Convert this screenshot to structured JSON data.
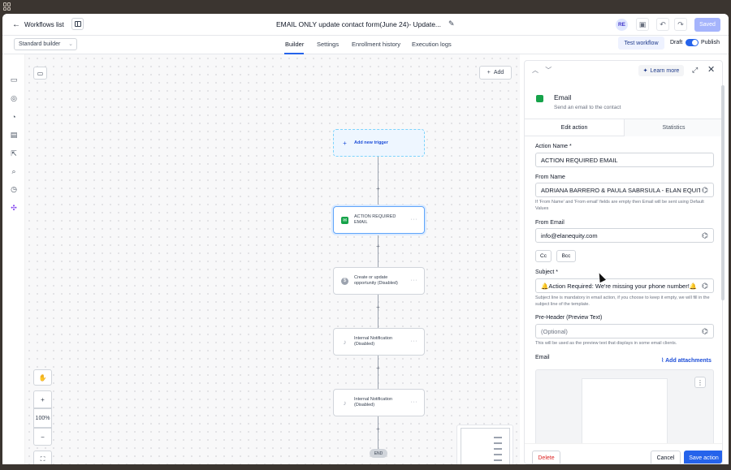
{
  "header": {
    "back_label": "Workflows list",
    "workflow_title": "EMAIL ONLY update contact form(June 24)- Update...",
    "avatar_initials": "RE",
    "saved_label": "Saved"
  },
  "subbar": {
    "builder_select": "Standard builder",
    "tabs": [
      {
        "label": "Builder",
        "active": true
      },
      {
        "label": "Settings",
        "active": false
      },
      {
        "label": "Enrollment history",
        "active": false
      },
      {
        "label": "Execution logs",
        "active": false
      }
    ],
    "test_label": "Test workflow",
    "draft_label": "Draft",
    "publish_label": "Publish",
    "published_on": true
  },
  "canvas": {
    "add_label": "Add",
    "nodes": [
      {
        "label": "Add new trigger",
        "kind": "trigger"
      },
      {
        "label": "ACTION REQUIRED EMAIL",
        "kind": "email",
        "selected": true
      },
      {
        "label": "Create or update opportunity (Disabled)",
        "kind": "opportunity"
      },
      {
        "label": "Internal Notification (Disabled)",
        "kind": "notification"
      },
      {
        "label": "Internal Notification (Disabled)",
        "kind": "notification"
      }
    ],
    "end_label": "END",
    "zoom_level": "100%"
  },
  "panel": {
    "learn_more": "Learn more",
    "title": "Email",
    "subtitle": "Send an email to the contact",
    "tabs": [
      "Edit action",
      "Statistics"
    ],
    "fields": {
      "action_name_label": "Action Name *",
      "action_name_value": "ACTION REQUIRED EMAIL",
      "from_name_label": "From Name",
      "from_name_value": "ADRIANA BARRERO & PAULA SABRSULA - ELAN EQUITY",
      "from_hint": "If 'From Name' and 'From email' fields are empty then Email will be sent using Default Values",
      "from_email_label": "From Email",
      "from_email_value": "info@elanequity.com",
      "cc_label": "Cc",
      "bcc_label": "Bcc",
      "subject_label": "Subject *",
      "subject_value": "🔔Action Required: We're missing your phone number!🔔",
      "subject_hint": "Subject line is mandatory in email action, if you choose to keep it empty, we will fill in the subject line of the template.",
      "preheader_label": "Pre-Header (Preview Text)",
      "preheader_placeholder": "(Optional)",
      "preheader_hint": "This will be used as the preview text that displays in some email clients.",
      "email_label": "Email",
      "add_attachments": "Add attachments"
    },
    "footer": {
      "delete_label": "Delete",
      "cancel_label": "Cancel",
      "save_label": "Save action"
    }
  }
}
